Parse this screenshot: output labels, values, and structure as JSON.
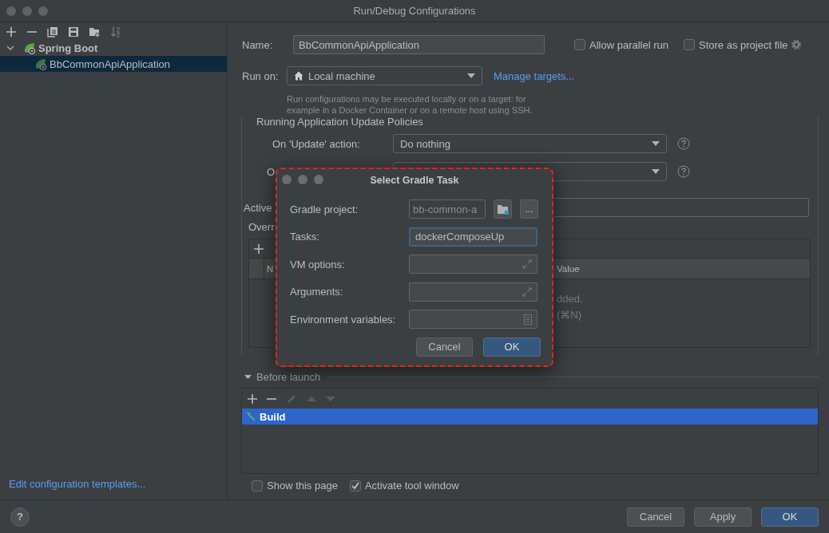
{
  "window": {
    "title": "Run/Debug Configurations"
  },
  "sidebar": {
    "tree": [
      {
        "label": "Spring Boot",
        "expanded": true,
        "children": [
          {
            "label": "BbCommonApiApplication",
            "selected": true
          }
        ]
      }
    ],
    "footer_link": "Edit configuration templates..."
  },
  "form": {
    "name": {
      "label": "Name:",
      "value": "BbCommonApiApplication"
    },
    "options": [
      {
        "label": "Allow parallel run",
        "checked": false
      },
      {
        "label": "Store as project file",
        "checked": false
      }
    ],
    "run_on": {
      "label": "Run on:",
      "value": "Local machine",
      "link": "Manage targets...",
      "hint": "Run configurations may be executed locally or on a target: for example in a Docker Container or on a remote host using SSH."
    },
    "update_policies": {
      "title": "Running Application Update Policies",
      "rows": [
        {
          "label": "On 'Update' action:",
          "value": "Do nothing"
        },
        {
          "label": "O"
        }
      ]
    },
    "active_label": "Active",
    "override_label": "Overr",
    "table": {
      "columns": [
        "N",
        "Value"
      ],
      "empty_text": [
        "dded.",
        "(⌘N)"
      ]
    },
    "before_launch": {
      "title": "Before launch",
      "expanded": true,
      "items": [
        {
          "label": "Build",
          "selected": true
        }
      ]
    },
    "page_options": [
      {
        "label": "Show this page",
        "checked": false
      },
      {
        "label": "Activate tool window",
        "checked": true
      }
    ]
  },
  "footer": {
    "help": "?",
    "buttons": [
      {
        "label": "Cancel",
        "default": false
      },
      {
        "label": "Apply",
        "default": false
      },
      {
        "label": "OK",
        "default": true
      }
    ]
  },
  "dialog": {
    "title": "Select Gradle Task",
    "fields": [
      {
        "label": "Gradle project:",
        "value": "bb-common-a",
        "kind": "project",
        "button": "..."
      },
      {
        "label": "Tasks:",
        "value": "dockerComposeUp",
        "kind": "text",
        "focused": true
      },
      {
        "label": "VM options:",
        "kind": "expand",
        "focused": false
      },
      {
        "label": "Arguments:",
        "kind": "expand",
        "focused": false
      },
      {
        "label": "Environment variables:",
        "kind": "env",
        "focused": false
      }
    ],
    "buttons": [
      {
        "label": "Cancel",
        "default": false
      },
      {
        "label": "OK",
        "default": true
      }
    ]
  }
}
